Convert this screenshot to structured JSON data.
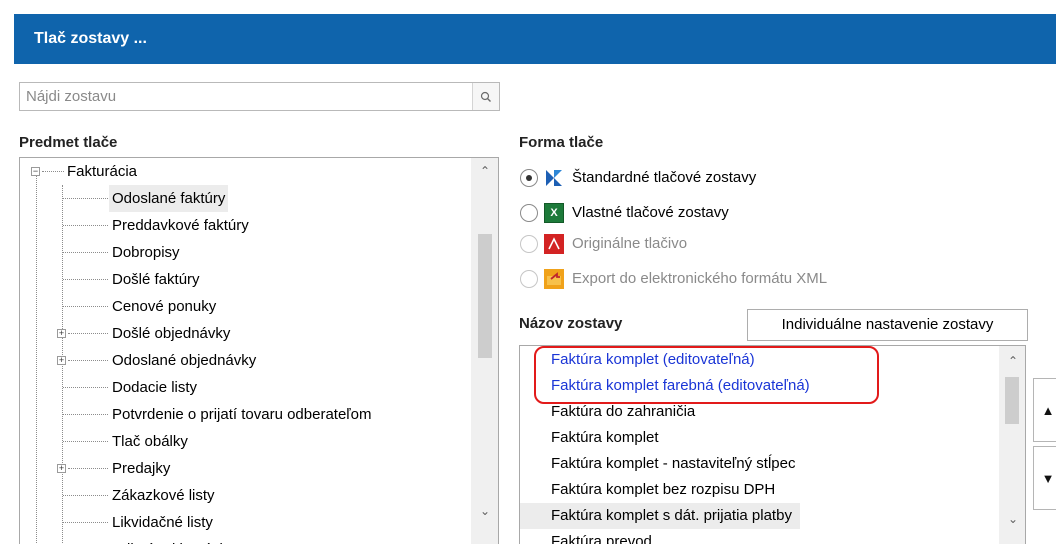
{
  "window": {
    "title": "Tlač zostavy ..."
  },
  "search": {
    "placeholder": "Nájdi zostavu",
    "value": ""
  },
  "subject": {
    "title": "Predmet tlače",
    "root": "Fakturácia",
    "items": [
      {
        "label": "Odoslané faktúry",
        "expandable": false,
        "selected": true
      },
      {
        "label": "Preddavkové faktúry",
        "expandable": false
      },
      {
        "label": "Dobropisy",
        "expandable": false
      },
      {
        "label": "Došlé faktúry",
        "expandable": false
      },
      {
        "label": "Cenové ponuky",
        "expandable": false
      },
      {
        "label": "Došlé objednávky",
        "expandable": true
      },
      {
        "label": "Odoslané objednávky",
        "expandable": true
      },
      {
        "label": "Dodacie listy",
        "expandable": false
      },
      {
        "label": "Potvrdenie o prijatí tovaru odberateľom",
        "expandable": false
      },
      {
        "label": "Tlač obálky",
        "expandable": false
      },
      {
        "label": "Predajky",
        "expandable": true
      },
      {
        "label": "Zákazkové listy",
        "expandable": false
      },
      {
        "label": "Likvidačné listy",
        "expandable": false
      },
      {
        "label": "Prijaté reklamácie",
        "expandable": true
      }
    ]
  },
  "form": {
    "title": "Forma tlače",
    "options": [
      {
        "label": "Štandardné tlačové zostavy",
        "icon": "kros-icon",
        "checked": true,
        "disabled": false
      },
      {
        "label": "Vlastné tlačové zostavy",
        "icon": "excel-icon",
        "checked": false,
        "disabled": false
      },
      {
        "label": "Originálne tlačivo",
        "icon": "pdf-icon",
        "checked": false,
        "disabled": true
      },
      {
        "label": "Export do elektronického formátu XML",
        "icon": "export-folder-icon",
        "checked": false,
        "disabled": true
      }
    ]
  },
  "reports": {
    "title": "Názov zostavy",
    "individual_button": "Individuálne nastavenie zostavy",
    "items": [
      {
        "label": "Faktúra komplet (editovateľná)",
        "highlight": true
      },
      {
        "label": "Faktúra komplet farebná (editovateľná)",
        "highlight": true
      },
      {
        "label": "Faktúra do zahraničia"
      },
      {
        "label": "Faktúra komplet"
      },
      {
        "label": "Faktúra komplet - nastaviteľný stĺpec"
      },
      {
        "label": "Faktúra komplet bez rozpisu DPH"
      },
      {
        "label": "Faktúra komplet s dát. prijatia platby",
        "selected": true
      },
      {
        "label": "Faktúra prevod"
      }
    ]
  },
  "icons": {
    "search": "search-icon",
    "move_up": "move-up-icon",
    "move_down": "move-down-icon",
    "expand": "plus-expander-icon",
    "collapse": "minus-expander-icon"
  },
  "colors": {
    "titlebar": "#0f64ac",
    "highlight_text": "#1a35d6",
    "highlight_outline": "#e21a1a"
  }
}
